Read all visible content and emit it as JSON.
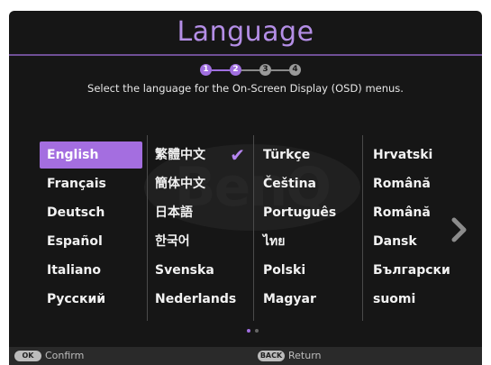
{
  "title": "Language",
  "subtitle": "Select the language for the On-Screen Display (OSD) menus.",
  "steps": [
    "1",
    "2",
    "3",
    "4"
  ],
  "current_step": 2,
  "watermark": "BenQ",
  "languages": [
    [
      "English",
      "Français",
      "Deutsch",
      "Español",
      "Italiano",
      "Русский"
    ],
    [
      "繁體中文",
      "簡体中文",
      "日本語",
      "한국어",
      "Svenska",
      "Nederlands"
    ],
    [
      "Türkçe",
      "Čeština",
      "Português",
      "ไทย",
      "Polski",
      "Magyar"
    ],
    [
      "Hrvatski",
      "Română",
      "Română",
      "Dansk",
      "Български",
      "suomi"
    ]
  ],
  "selected_language": "English",
  "checked_language": "繁體中文",
  "page_indicator": {
    "total": 2,
    "current": 1
  },
  "footer": {
    "confirm_key": "OK",
    "confirm_label": "Confirm",
    "return_key": "BACK",
    "return_label": "Return"
  },
  "colors": {
    "accent": "#a46ee0",
    "title": "#b48ee6",
    "background": "#161616"
  },
  "icons": {
    "check": "check-icon",
    "next": "chevron-right-icon"
  }
}
